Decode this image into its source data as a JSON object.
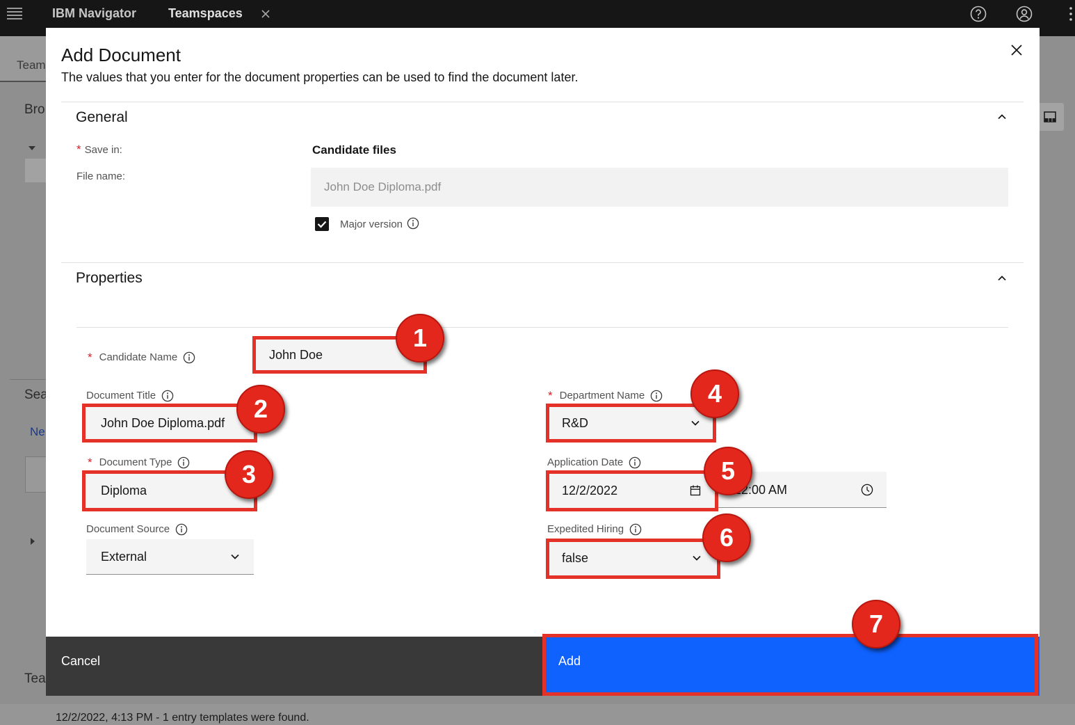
{
  "colors": {
    "topbar_bg": "#161616",
    "overlay_gray": "#8f8f8f",
    "dialog_bg": "#ffffff",
    "field_bg": "#f4f4f4",
    "primary_button": "#0f62fe",
    "secondary_button": "#393939",
    "required_red": "#da1e28",
    "annotation_red": "#e53228"
  },
  "topbar": {
    "app_name": "IBM Navigator",
    "tab_label": "Teamspaces",
    "icons": [
      "hamburger-menu-icon",
      "tab-close-icon",
      "help-icon",
      "user-avatar-icon",
      "overflow-menu-icon"
    ]
  },
  "background_page": {
    "tab_fragment": "Team",
    "browse_fragment": "Bro",
    "search_fragment": "Sea",
    "new_fragment": "Ne",
    "teamspace_fragment": "Tea",
    "status_message": "12/2/2022, 4:13 PM - 1 entry templates were found."
  },
  "dialog": {
    "title": "Add Document",
    "description": "The values that you enter for the document properties can be used to find the document later.",
    "required_mark": "*",
    "general": {
      "heading": "General",
      "expanded": true,
      "save_in": {
        "label": "Save in:",
        "value": "Candidate files",
        "required": true
      },
      "file_name": {
        "label": "File name:",
        "value": "John Doe Diploma.pdf",
        "disabled": true
      },
      "major_version": {
        "label": "Major version",
        "checked": true
      }
    },
    "properties": {
      "heading": "Properties",
      "expanded": true,
      "fields": {
        "candidate_name": {
          "label": "Candidate Name",
          "value": "John Doe",
          "required": true
        },
        "document_title": {
          "label": "Document Title",
          "value": "John Doe Diploma.pdf",
          "required": false
        },
        "document_type": {
          "label": "Document Type",
          "value": "Diploma",
          "required": true
        },
        "document_source": {
          "label": "Document Source",
          "value": "External",
          "required": false
        },
        "department_name": {
          "label": "Department Name",
          "value": "R&D",
          "required": true
        },
        "application_date": {
          "label": "Application Date",
          "date": "12/2/2022",
          "time": "12:00 AM",
          "required": false
        },
        "expedited_hiring": {
          "label": "Expedited Hiring",
          "value": "false",
          "required": false
        }
      }
    },
    "buttons": {
      "cancel": "Cancel",
      "add": "Add"
    }
  },
  "annotations": [
    "1",
    "2",
    "3",
    "4",
    "5",
    "6",
    "7"
  ]
}
